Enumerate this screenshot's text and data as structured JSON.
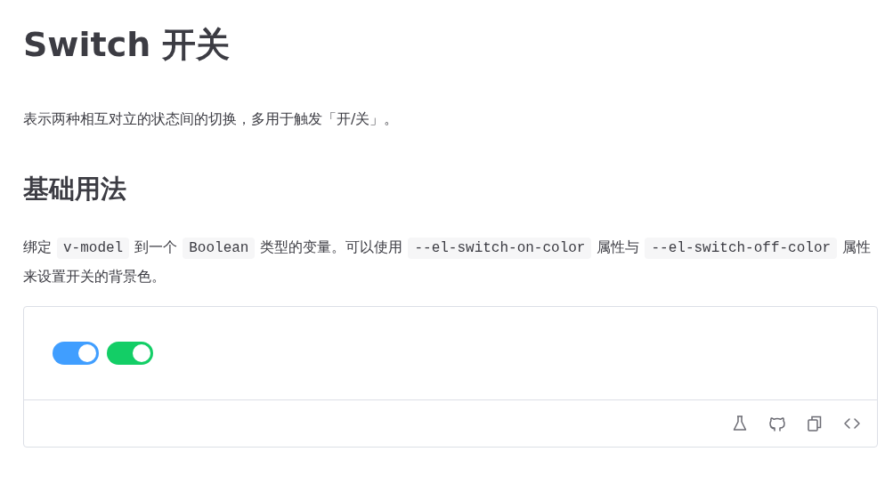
{
  "title": "Switch 开关",
  "intro": "表示两种相互对立的状态间的切换，多用于触发「开/关」。",
  "section": {
    "heading": "基础用法",
    "description": [
      {
        "kind": "text",
        "text": "绑定"
      },
      {
        "kind": "code",
        "text": "v-model"
      },
      {
        "kind": "text",
        "text": "到一个"
      },
      {
        "kind": "code",
        "text": "Boolean"
      },
      {
        "kind": "text",
        "text": "类型的变量。可以使用"
      },
      {
        "kind": "code",
        "text": "--el-switch-on-color"
      },
      {
        "kind": "text",
        "text": "属性与"
      },
      {
        "kind": "code",
        "text": "--el-switch-off-color"
      },
      {
        "kind": "text",
        "text": "属性来设置开关的背景色。"
      }
    ],
    "demo": {
      "switches": [
        {
          "on": true,
          "color": "#409eff"
        },
        {
          "on": true,
          "color": "#13ce66"
        }
      ],
      "toolbar": [
        {
          "kind": "flask"
        },
        {
          "kind": "cat"
        },
        {
          "kind": "copy"
        },
        {
          "kind": "code"
        }
      ]
    }
  }
}
